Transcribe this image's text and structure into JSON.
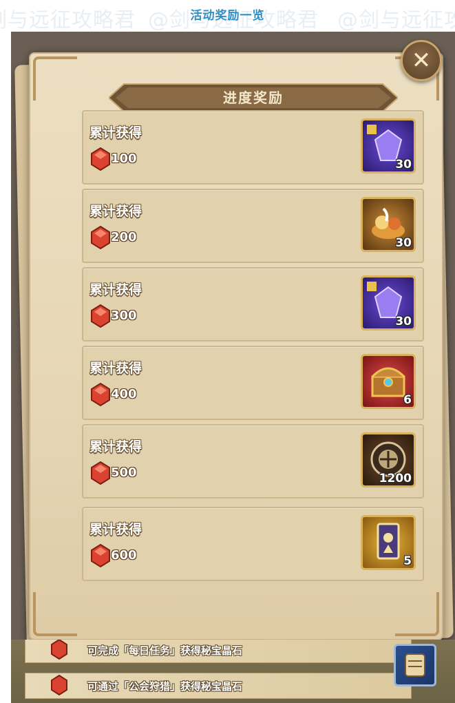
{
  "watermarks": [
    "剑与远征攻略君",
    "@剑与远征攻略君",
    "@剑与远征攻"
  ],
  "page_title": "活动奖励一览",
  "panel": {
    "title": "进度奖励",
    "close_icon": "close-x-icon",
    "rows": [
      {
        "label": "累计获得",
        "amount": "100",
        "reward_count": "30",
        "reward_icon": "purple-shard-icon"
      },
      {
        "label": "累计获得",
        "amount": "200",
        "reward_count": "30",
        "reward_icon": "food-pile-icon"
      },
      {
        "label": "累计获得",
        "amount": "300",
        "reward_count": "30",
        "reward_icon": "purple-shard-icon"
      },
      {
        "label": "累计获得",
        "amount": "400",
        "reward_count": "6",
        "reward_icon": "treasure-chest-icon"
      },
      {
        "label": "累计获得",
        "amount": "500",
        "reward_count": "1200",
        "reward_icon": "bronze-emblem-icon"
      },
      {
        "label": "累计获得",
        "amount": "600",
        "reward_count": "5",
        "reward_icon": "scroll-card-icon"
      }
    ]
  },
  "tasks": [
    {
      "text": "可完成「每日任务」获得秘宝晶石"
    },
    {
      "text": "可通过「公会狩猎」获得秘宝晶石"
    }
  ],
  "colors": {
    "title_blue": "#2f8fc4",
    "panel_parchment": "#e6d6b4",
    "banner_brown": "#8a6a45",
    "gem_red": "#e0503a"
  }
}
